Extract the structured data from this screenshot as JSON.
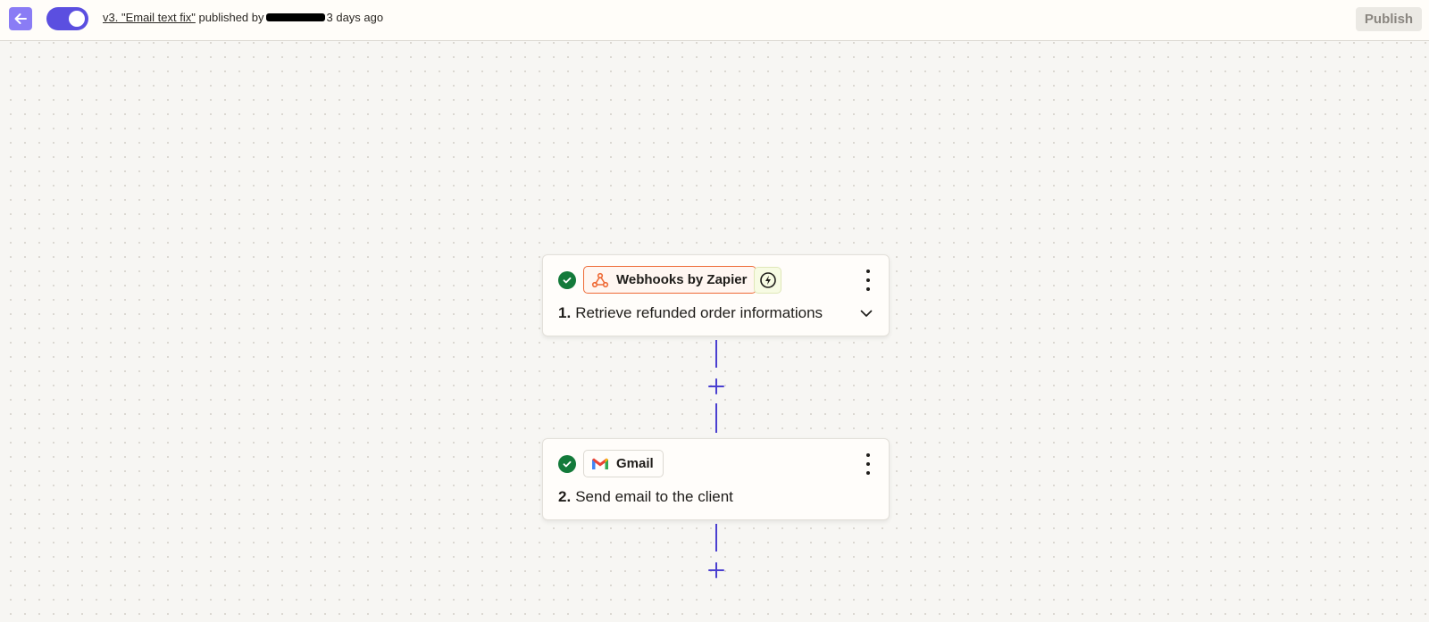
{
  "topbar": {
    "version_label": "v3. \"Email text fix\"",
    "published_by_text": "published by",
    "time_ago": "3 days ago",
    "publish_label": "Publish",
    "toggle_on": true
  },
  "steps": [
    {
      "app_name": "Webhooks by Zapier",
      "number": "1.",
      "title": "Retrieve refunded order informations",
      "icon": "webhooks-icon",
      "has_trigger_badge": true,
      "status": "check-icon"
    },
    {
      "app_name": "Gmail",
      "number": "2.",
      "title": "Send email to the client",
      "icon": "gmail-icon",
      "has_trigger_badge": false,
      "status": "check-icon"
    }
  ],
  "colors": {
    "accent": "#5b4fe0",
    "success": "#137a3a",
    "webhooks_orange": "#ee6a36",
    "connector": "#4a3fd0"
  }
}
